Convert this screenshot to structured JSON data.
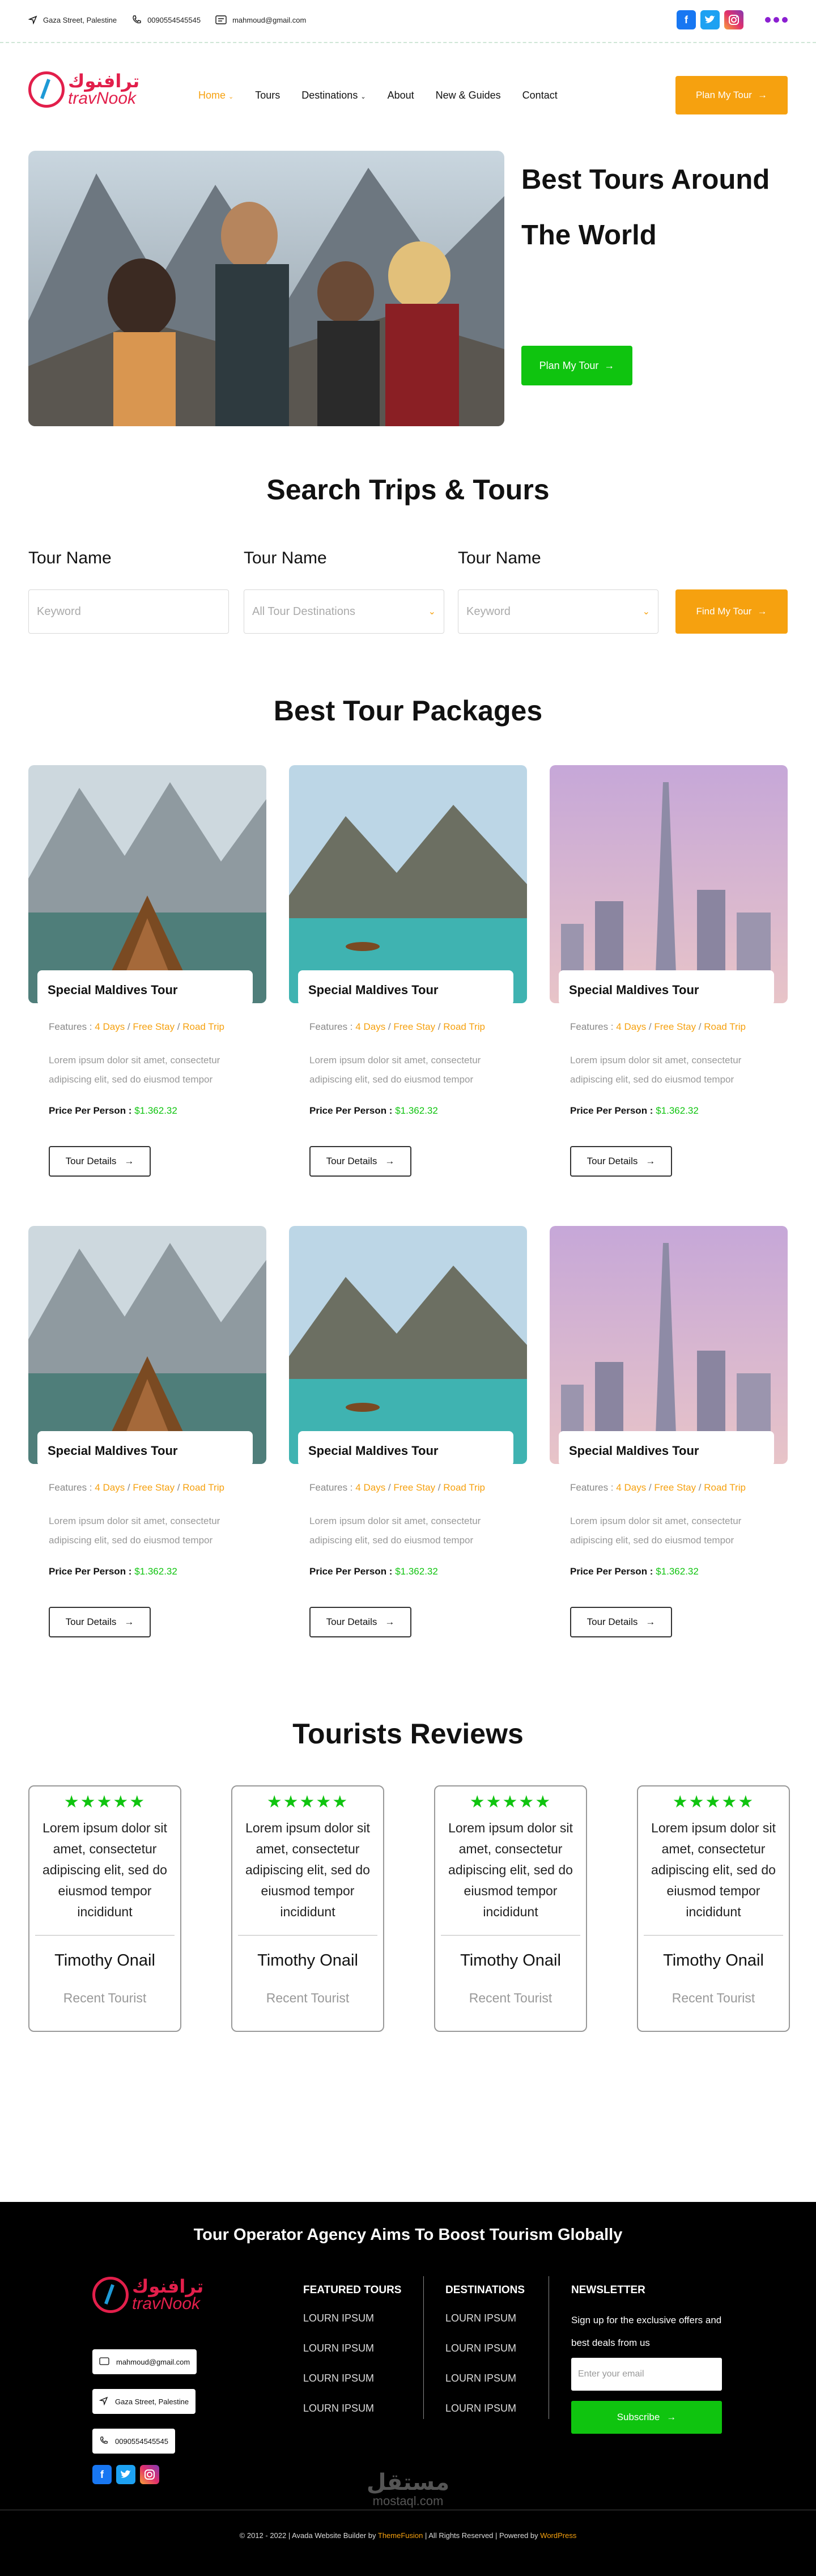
{
  "topbar": {
    "address": "Gaza Street, Palestine",
    "phone": "0090554545545",
    "email": "mahmoud@gmail.com",
    "social": [
      "facebook-icon",
      "twitter-icon",
      "instagram-icon"
    ]
  },
  "nav": {
    "logo_ar": "ترافنوك",
    "logo_en": "travNook",
    "items": [
      "Home",
      "Tours",
      "Destinations",
      "About",
      "New & Guides",
      "Contact"
    ],
    "cta": "Plan My Tour"
  },
  "hero": {
    "title_line1": "Best Tours Around",
    "title_line2": "The World",
    "button": "Plan My Tour"
  },
  "search": {
    "heading": "Search Trips & Tours",
    "fields": [
      {
        "label": "Tour Name",
        "placeholder": "Keyword"
      },
      {
        "label": "Tour Name",
        "placeholder": "All Tour Destinations"
      },
      {
        "label": "Tour Name",
        "placeholder": "Keyword"
      }
    ],
    "button": "Find My Tour"
  },
  "packages": {
    "heading": "Best Tour Packages",
    "card": {
      "title": "Special Maldives Tour",
      "features_label": "Features :",
      "features": [
        "4 Days",
        "Free Stay",
        "Road Trip"
      ],
      "desc_line1": "Lorem ipsum dolor sit amet, consectetur",
      "desc_line2": "adipiscing elit, sed do eiusmod tempor",
      "price_label": "Price Per Person :",
      "price": "$1.362.32",
      "button": "Tour Details"
    }
  },
  "reviews": {
    "heading": "Tourists Reviews",
    "text_l1": "Lorem ipsum dolor sit",
    "text_l2": "amet, consectetur",
    "text_l3": "adipiscing elit, sed do",
    "text_l4": "eiusmod tempor",
    "text_l5": "incididunt",
    "name": "Timothy Onail",
    "role": "Recent Tourist",
    "stars": "★★★★★"
  },
  "footer": {
    "title": "Tour Operator Agency Aims To Boost Tourism Globally",
    "email": "mahmoud@gmail.com",
    "address": "Gaza Street, Palestine",
    "phone": "0090554545545",
    "featured_heading": "FEATURED TOURS",
    "dest_heading": "DESTINATIONS",
    "news_heading": "NEWSLETTER",
    "link": "LOURN IPSUM",
    "news_text": "Sign up for the exclusive offers and best deals from us",
    "news_placeholder": "Enter your email",
    "news_button": "Subscribe",
    "watermark_ar": "مستقل",
    "watermark_en": "mostaql.com",
    "copy_a": "© 2012 - 2022 | Avada Website Builder by ",
    "copy_b": "ThemeFusion",
    "copy_c": " | All Rights Reserved | Powered by ",
    "copy_d": "WordPress"
  }
}
